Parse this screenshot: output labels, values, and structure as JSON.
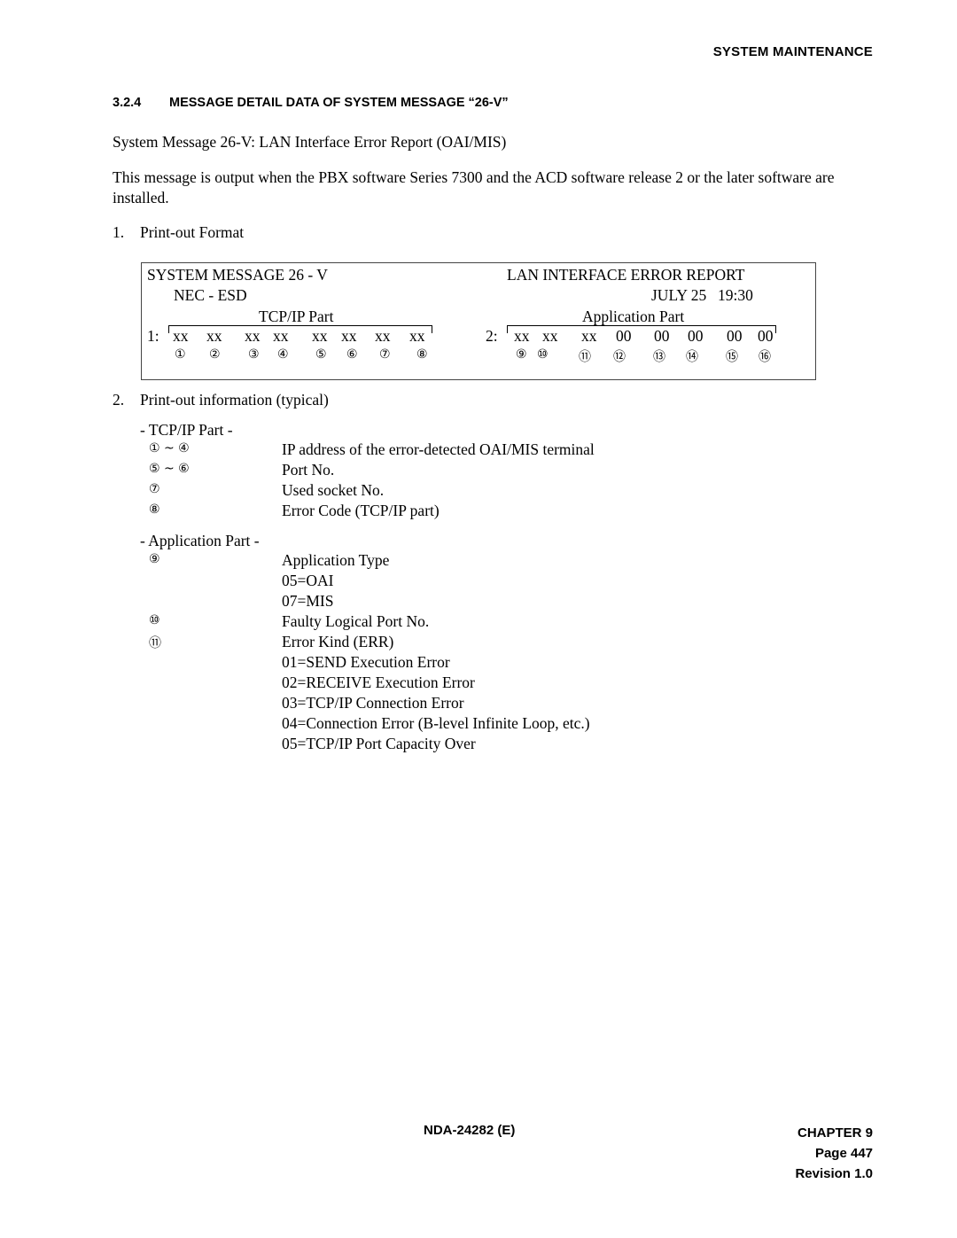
{
  "header": {
    "running_head": "SYSTEM MAINTENANCE",
    "section_number": "3.2.4",
    "section_title": "MESSAGE DETAIL DATA OF SYSTEM MESSAGE “26-V”"
  },
  "body": {
    "subtitle": "System Message 26-V: LAN Interface Error Report (OAI/MIS)",
    "intro": "This message is output when the PBX software Series 7300 and the ACD software release 2 or the later software are installed.",
    "list1_number": "1.",
    "list1_label": "Print-out Format",
    "list2_number": "2.",
    "list2_label": "Print-out information (typical)"
  },
  "printout": {
    "title_left": "SYSTEM MESSAGE 26 - V",
    "title_right": "LAN INTERFACE ERROR REPORT",
    "origin": "NEC - ESD",
    "date": "JULY 25",
    "time": "19:30",
    "part1_label": "TCP/IP Part",
    "part2_label": "Application Part",
    "row1_prefix": "1:",
    "row2_prefix": "2:",
    "row1_fields": [
      "xx",
      "xx",
      "xx",
      "xx",
      "xx",
      "xx",
      "xx",
      "xx"
    ],
    "row2_fields": [
      "xx",
      "xx",
      "xx",
      "00",
      "00",
      "00",
      "00",
      "00"
    ],
    "row1_markers": [
      "①",
      "②",
      "③",
      "④",
      "⑤",
      "⑥",
      "⑦",
      "⑧"
    ],
    "row2_markers": [
      "⑨",
      "⑩",
      "⑪",
      "⑫",
      "⑬",
      "⑭",
      "⑮",
      "⑯"
    ]
  },
  "info": {
    "tcp_heading": "- TCP/IP Part -",
    "tcp_rows": [
      {
        "key": "① ~ ④",
        "value": "IP address of the error-detected OAI/MIS terminal"
      },
      {
        "key": "⑤ ~ ⑥",
        "value": "Port No."
      },
      {
        "key": "⑦",
        "value": "Used socket No."
      },
      {
        "key": "⑧",
        "value": "Error Code (TCP/IP part)"
      }
    ],
    "app_heading": "- Application Part -",
    "app_rows": [
      {
        "key": "⑨",
        "value": "Application Type"
      },
      {
        "key": "",
        "value": "05=OAI"
      },
      {
        "key": "",
        "value": "07=MIS"
      },
      {
        "key": "⑩",
        "value": "Faulty Logical Port No."
      },
      {
        "key": "⑪",
        "value": "Error Kind (ERR)"
      },
      {
        "key": "",
        "value": "01=SEND Execution Error"
      },
      {
        "key": "",
        "value": "02=RECEIVE Execution Error"
      },
      {
        "key": "",
        "value": "03=TCP/IP Connection Error"
      },
      {
        "key": "",
        "value": "04=Connection Error (B-level Infinite Loop, etc.)"
      },
      {
        "key": "",
        "value": "05=TCP/IP Port Capacity Over"
      }
    ]
  },
  "footer": {
    "doc_number": "NDA-24282 (E)",
    "chapter": "CHAPTER 9",
    "page": "Page 447",
    "revision": "Revision 1.0"
  }
}
